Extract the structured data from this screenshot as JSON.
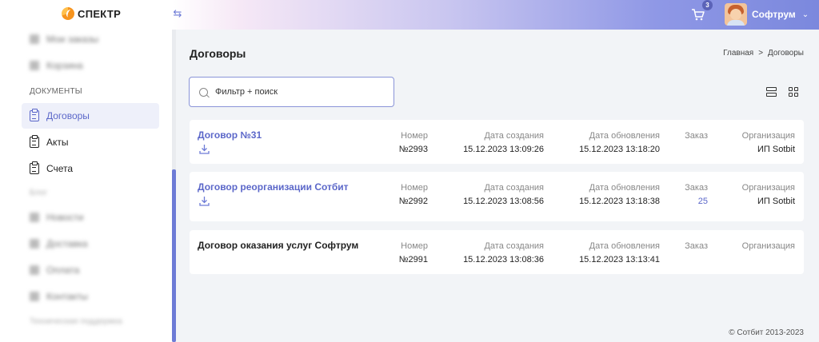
{
  "header": {
    "logo_text": "СПЕКТР",
    "cart_count": "3",
    "user_name": "Софтрум"
  },
  "sidebar": {
    "items_top": [
      {
        "label": "Мои заказы",
        "blurred": true
      },
      {
        "label": "Корзина",
        "blurred": true
      }
    ],
    "section_documents": "ДОКУМЕНТЫ",
    "documents": [
      {
        "label": "Договоры",
        "active": true
      },
      {
        "label": "Акты",
        "active": false
      },
      {
        "label": "Счета",
        "active": false
      }
    ],
    "section_other": "Блог",
    "items_bottom": [
      {
        "label": "Новости",
        "blurred": true
      },
      {
        "label": "Доставка",
        "blurred": true
      },
      {
        "label": "Оплата",
        "blurred": true
      },
      {
        "label": "Контакты",
        "blurred": true
      }
    ],
    "section_support": "Техническая поддержка"
  },
  "main": {
    "title": "Договоры",
    "breadcrumb": {
      "home": "Главная",
      "separator": ">",
      "current": "Договоры"
    },
    "search_placeholder": "Фильтр + поиск"
  },
  "columns": {
    "number": "Номер",
    "created": "Дата создания",
    "updated": "Дата обновления",
    "order": "Заказ",
    "org": "Организация"
  },
  "contracts": [
    {
      "title": "Договор №31",
      "number": "№2993",
      "created": "15.12.2023 13:09:26",
      "updated": "15.12.2023 13:18:20",
      "order": "",
      "org": "ИП Sotbit"
    },
    {
      "title": "Договор реорганизации Сотбит",
      "number": "№2992",
      "created": "15.12.2023 13:08:56",
      "updated": "15.12.2023 13:18:38",
      "order": "25",
      "org": "ИП Sotbit"
    },
    {
      "title": "Договор оказания услуг Софтрум",
      "number": "№2991",
      "created": "15.12.2023 13:08:36",
      "updated": "15.12.2023 13:13:41",
      "order": "",
      "org": ""
    }
  ],
  "footer": "© Сотбит 2013-2023"
}
